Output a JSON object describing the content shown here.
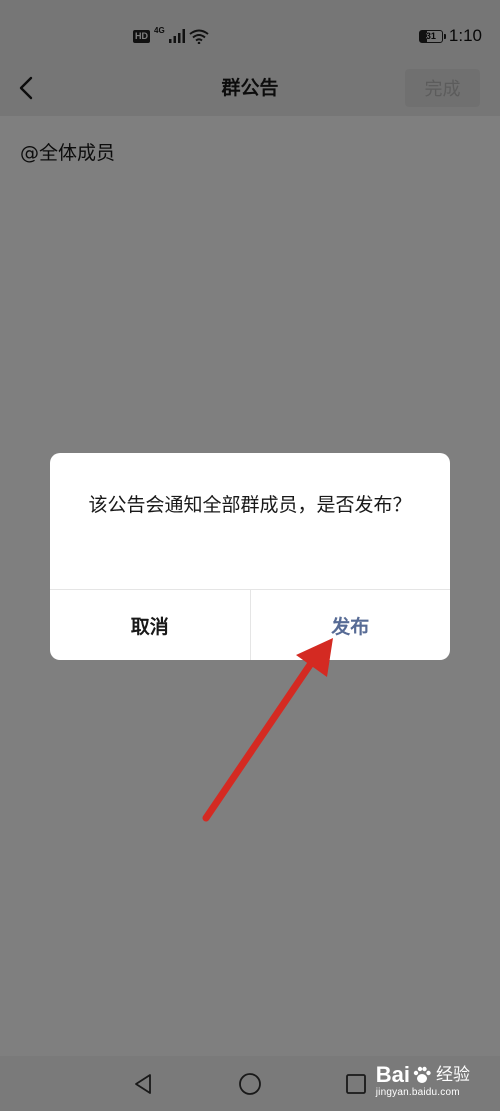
{
  "status_bar": {
    "hd": "HD",
    "network": "4G",
    "battery": "31",
    "time": "1:10",
    "icons": [
      "signal-icon",
      "wifi-icon",
      "battery-icon"
    ]
  },
  "nav": {
    "back_icon": "chevron-left-icon",
    "title": "群公告",
    "done_label": "完成"
  },
  "content": {
    "text": "@全体成员"
  },
  "dialog": {
    "message": "该公告会通知全部群成员，是否发布？",
    "cancel_label": "取消",
    "confirm_label": "发布"
  },
  "system_nav": [
    "back-triangle-icon",
    "home-circle-icon",
    "recents-square-icon"
  ],
  "watermark": {
    "brand_a": "Bai",
    "brand_b": "经验",
    "url": "jingyan.baidu.com"
  },
  "colors": {
    "accent": "#576b95",
    "annotation": "#d42a22",
    "mask": "rgba(0,0,0,0.5)"
  }
}
